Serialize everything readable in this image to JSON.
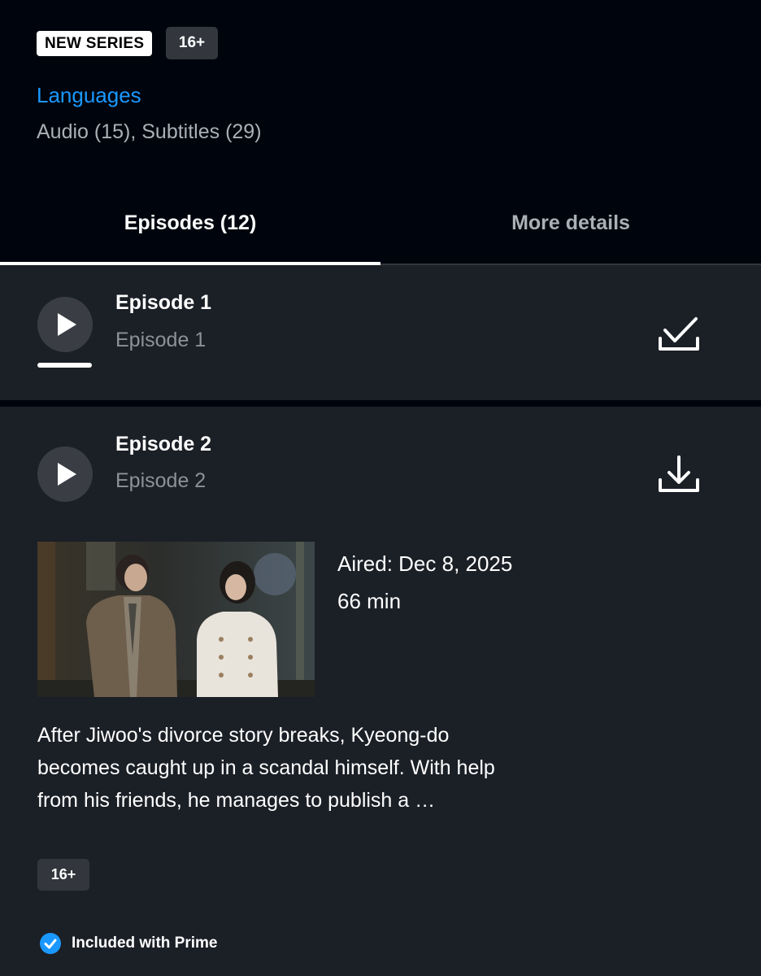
{
  "header": {
    "new_series_badge": "NEW SERIES",
    "rating_badge": "16+",
    "languages_label": "Languages",
    "languages_values": "Audio (15), Subtitles (29)"
  },
  "tabs": [
    {
      "label": "Episodes (12)",
      "selected": true
    },
    {
      "label": "More details",
      "selected": false
    }
  ],
  "episodes": [
    {
      "title": "Episode 1",
      "subtitle": "Episode 1",
      "watched_progress": 1.0,
      "download_state": "downloaded",
      "download_icon": "check-download-icon"
    },
    {
      "title": "Episode 2",
      "subtitle": "Episode 2",
      "download_state": "available",
      "download_icon": "download-icon",
      "aired": "Aired: Dec 8, 2025",
      "duration": "66 min",
      "synopsis": "After Jiwoo's divorce story breaks, Kyeong-do becomes caught up in a scandal himself. With help from his friends, he manages to publish a …",
      "rating": "16+",
      "included_text": "Included with Prime"
    }
  ],
  "colors": {
    "background": "#00050d",
    "card": "#1b1f26",
    "accent_blue": "#1a98ff",
    "muted_text": "#aab0b6",
    "badge_gray": "#33373d"
  }
}
